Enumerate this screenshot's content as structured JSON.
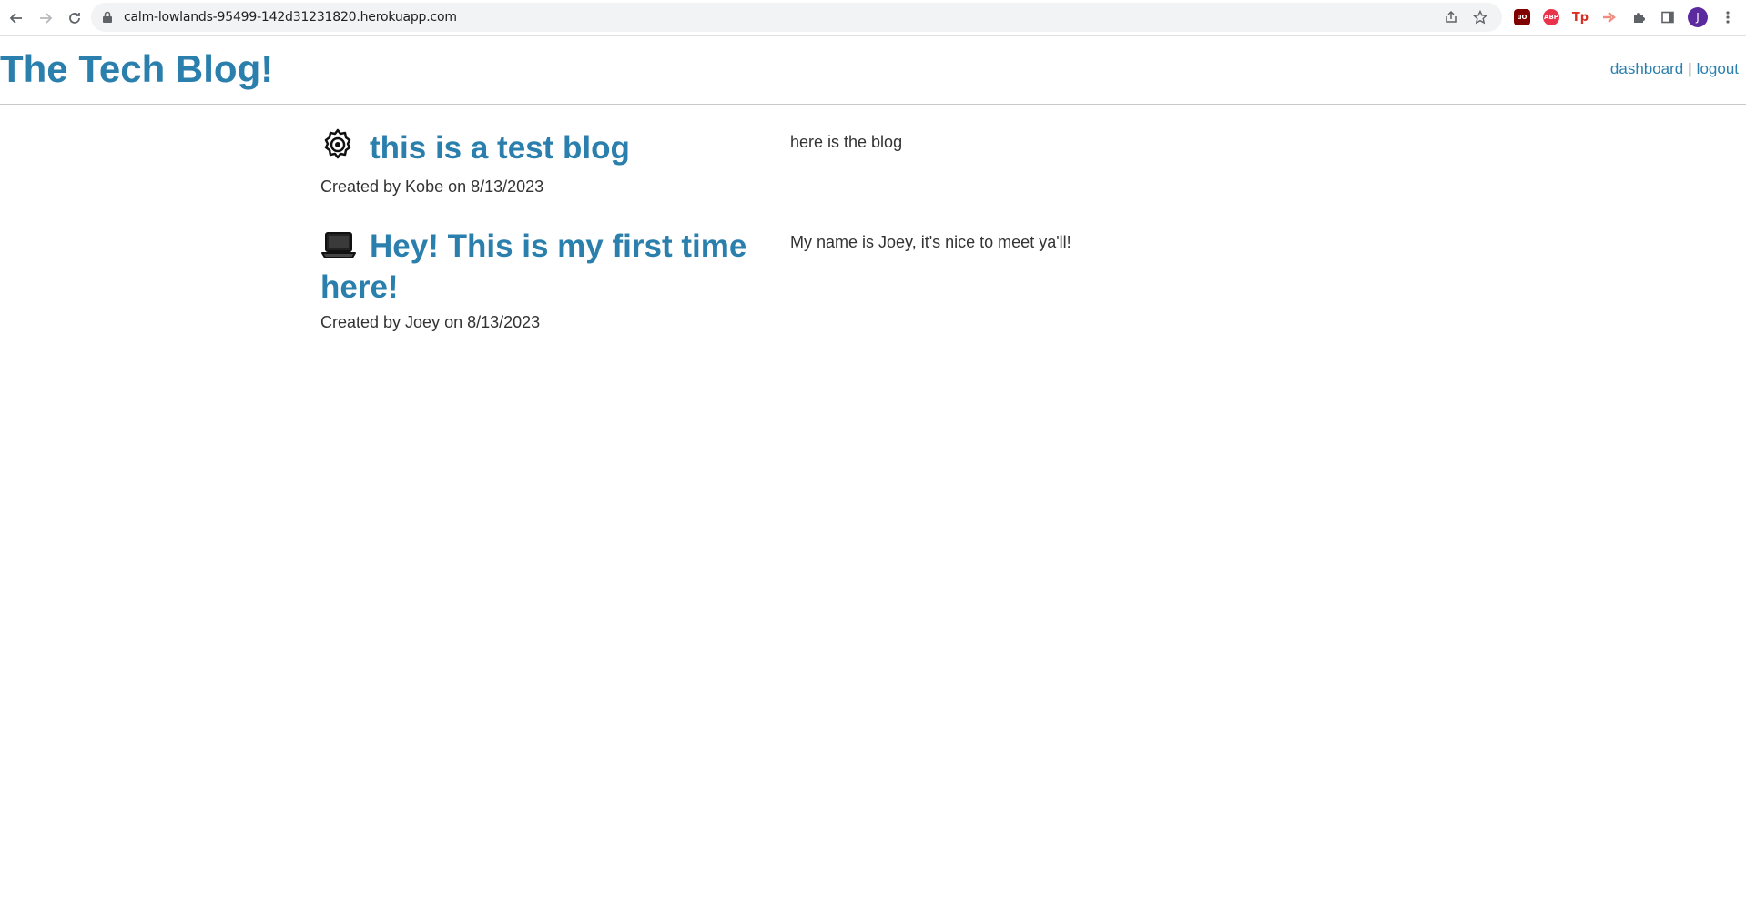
{
  "browser": {
    "url": "calm-lowlands-95499-142d31231820.herokuapp.com",
    "avatar_initial": "J",
    "extensions": [
      {
        "name": "ublock",
        "label": "uO",
        "color": "#800000"
      },
      {
        "name": "adblock-plus",
        "label": "ABP",
        "color": "#e8334a"
      },
      {
        "name": "tp",
        "label": "Tp",
        "color": "#d93025"
      },
      {
        "name": "arrow-ext",
        "label": "",
        "color": "#f28b82"
      }
    ]
  },
  "site": {
    "title": "The Tech Blog!",
    "nav": {
      "dashboard": "dashboard",
      "separator": "|",
      "logout": "logout"
    }
  },
  "posts": [
    {
      "icon": "gear-icon",
      "emoji": "⚙️",
      "title": "this is a test blog",
      "meta": "Created by Kobe on 8/13/2023",
      "body": "here is the blog"
    },
    {
      "icon": "laptop-icon",
      "emoji": "💻",
      "title": "Hey! This is my first time here!",
      "meta": "Created by Joey on 8/13/2023",
      "body": "My name is Joey, it's nice to meet ya'll!"
    }
  ],
  "colors": {
    "brand": "#2a7fad",
    "text": "#333333",
    "divider": "#c8c8c8"
  }
}
